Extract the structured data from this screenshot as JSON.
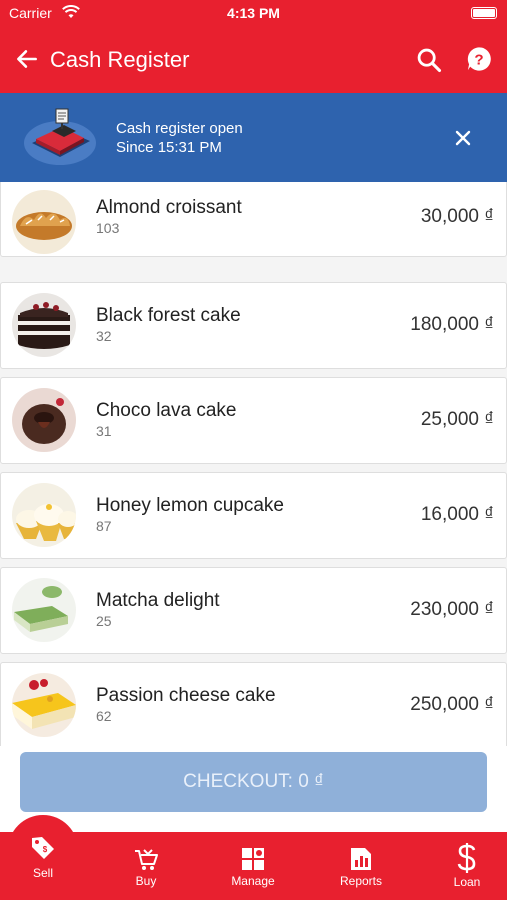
{
  "status_bar": {
    "carrier": "Carrier",
    "time": "4:13 PM"
  },
  "app_bar": {
    "title": "Cash Register"
  },
  "banner": {
    "line1": "Cash register open",
    "line2": "Since 15:31 PM"
  },
  "products": [
    {
      "name": "Almond croissant",
      "qty": "103",
      "price": "30,000 ₫"
    },
    {
      "name": "Black forest cake",
      "qty": "32",
      "price": "180,000 ₫"
    },
    {
      "name": "Choco lava cake",
      "qty": "31",
      "price": "25,000 ₫"
    },
    {
      "name": "Honey lemon cupcake",
      "qty": "87",
      "price": "16,000 ₫"
    },
    {
      "name": "Matcha delight",
      "qty": "25",
      "price": "230,000 ₫"
    },
    {
      "name": "Passion cheese cake",
      "qty": "62",
      "price": "250,000 ₫"
    }
  ],
  "checkout": {
    "label": "CHECKOUT: 0 ₫"
  },
  "bottom_nav": [
    {
      "label": "Sell",
      "icon": "price-tag-icon"
    },
    {
      "label": "Buy",
      "icon": "cart-icon"
    },
    {
      "label": "Manage",
      "icon": "grid-icon"
    },
    {
      "label": "Reports",
      "icon": "chart-icon"
    },
    {
      "label": "Loan",
      "icon": "dollar-icon"
    }
  ],
  "colors": {
    "brand_red": "#e8202f",
    "banner_blue": "#2e63ae",
    "checkout_disabled": "#8fb0d9"
  }
}
